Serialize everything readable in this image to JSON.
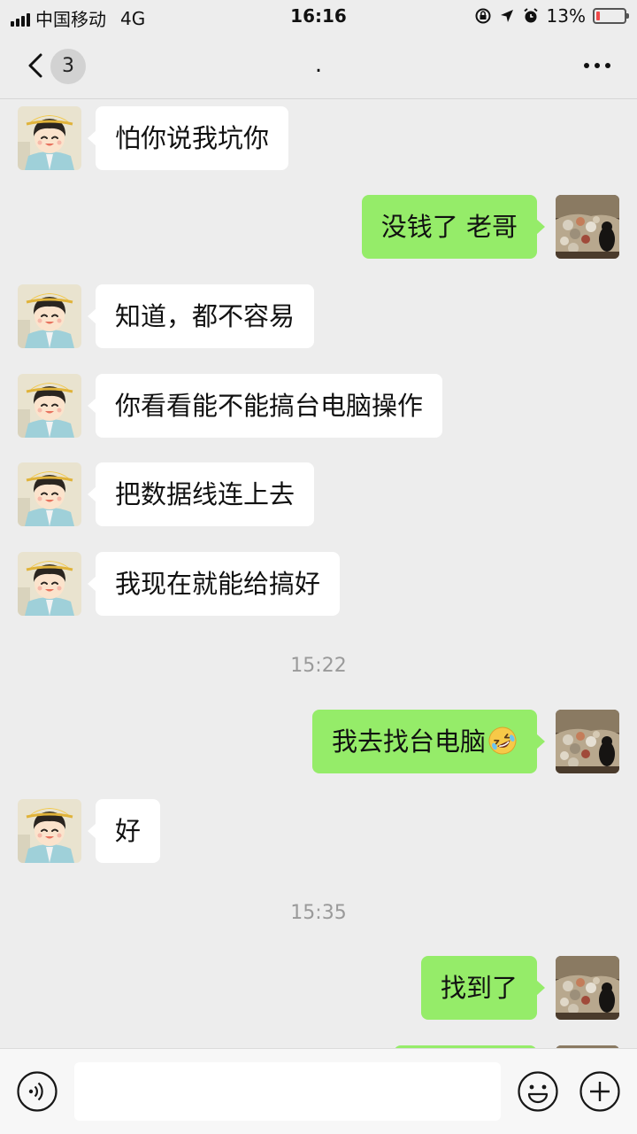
{
  "status_bar": {
    "carrier": "中国移动",
    "network": "4G",
    "time": "16:16",
    "battery_percent_label": "13%",
    "battery_level": 0.13
  },
  "nav": {
    "unread_count": "3",
    "title": "."
  },
  "messages": [
    {
      "side": "in",
      "text": "怕你说我坑你"
    },
    {
      "side": "out",
      "text": "没钱了 老哥"
    },
    {
      "side": "in",
      "text": "知道，都不容易"
    },
    {
      "side": "in",
      "text": "你看看能不能搞台电脑操作"
    },
    {
      "side": "in",
      "text": "把数据线连上去"
    },
    {
      "side": "in",
      "text": "我现在就能给搞好"
    },
    {
      "type": "time",
      "text": "15:22"
    },
    {
      "side": "out",
      "text": "我去找台电脑",
      "emoji": "rolling-laughing-emoji"
    },
    {
      "side": "in",
      "text": "好"
    },
    {
      "type": "time",
      "text": "15:35"
    },
    {
      "side": "out",
      "text": "找到了"
    }
  ],
  "input": {
    "value": "",
    "placeholder": ""
  },
  "colors": {
    "background": "#ededed",
    "outgoing_bubble": "#95ec69",
    "incoming_bubble": "#ffffff",
    "battery_low": "#f04a4a"
  },
  "icons": [
    "signal-icon",
    "back-icon",
    "more-icon",
    "voice-icon",
    "emoji-icon",
    "plus-icon",
    "lock-rotation-icon",
    "location-icon",
    "alarm-icon",
    "battery-icon"
  ]
}
